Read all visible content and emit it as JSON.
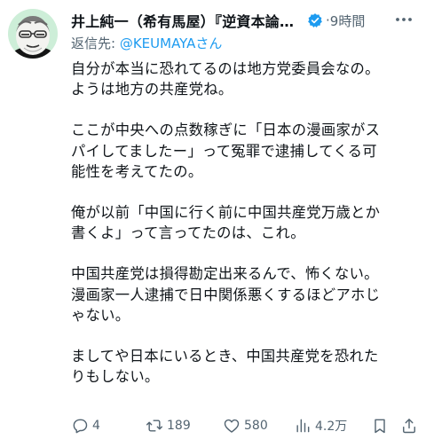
{
  "author": {
    "name": "井上純一（希有馬屋）『逆資本論』...",
    "verified": true
  },
  "meta": {
    "separator": "·",
    "time": "9時間"
  },
  "reply": {
    "prefix": "返信先: ",
    "handle": "@KEUMAYA",
    "suffix": "さん"
  },
  "paragraphs": [
    "自分が本当に恐れてるのは地方党委員会なの。\nようは地方の共産党ね。",
    "ここが中央への点数稼ぎに「日本の漫画家がス\nパイしてましたー」って冤罪で逮捕してくる可\n能性を考えてたの。",
    "俺が以前「中国に行く前に中国共産党万歳とか\n書くよ」って言ってたのは、これ。",
    "中国共産党は損得勘定出来るんで、怖くない。\n漫画家一人逮捕で日中関係悪くするほどアホじ\nゃない。",
    "ましてや日本にいるとき、中国共産党を恐れた\nりもしない。"
  ],
  "actions": {
    "replies": "4",
    "reposts": "189",
    "likes": "580",
    "views": "4.2万"
  },
  "colors": {
    "text": "#0f1419",
    "secondary": "#536471",
    "accent": "#1d9bf0",
    "verified_badge": "#1d9bf0"
  },
  "icons": {
    "reply": "reply-icon",
    "repost": "repost-icon",
    "like": "heart-icon",
    "views": "views-icon",
    "bookmark": "bookmark-icon",
    "share": "share-icon",
    "more": "more-icon",
    "verified": "verified-badge-icon"
  }
}
